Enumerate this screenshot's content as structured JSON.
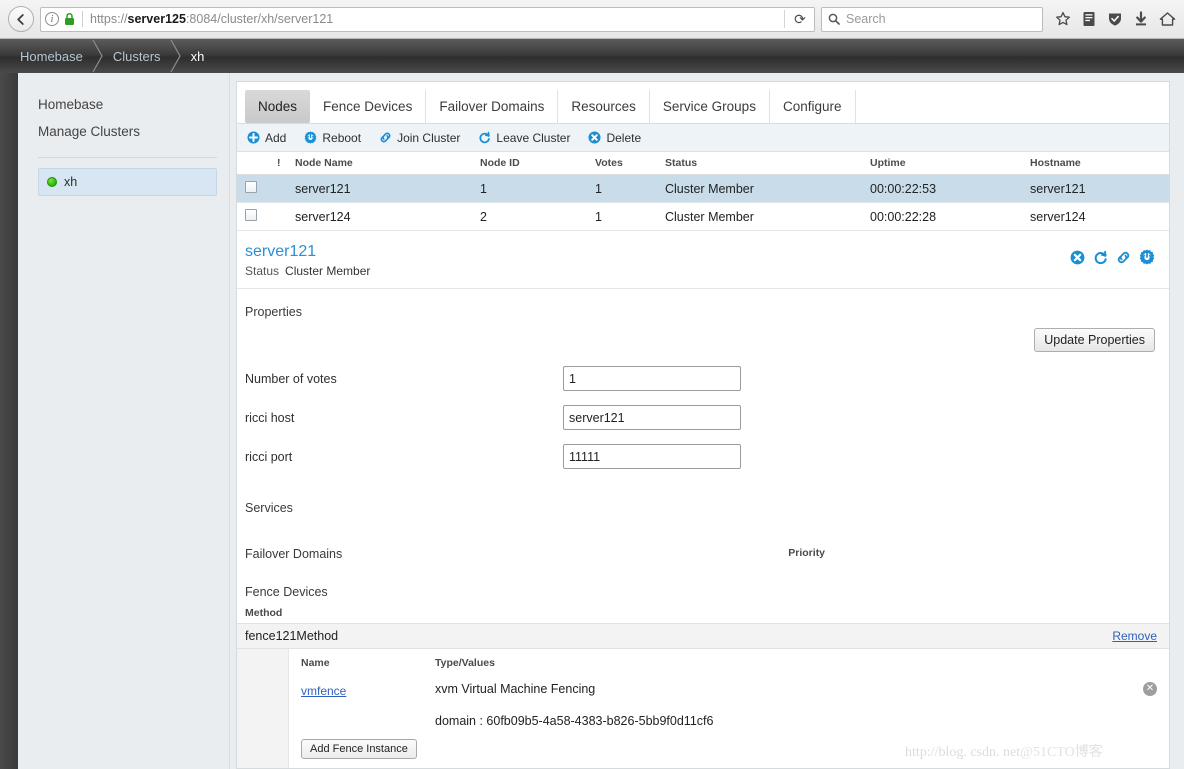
{
  "browser": {
    "back_icon": "back-arrow-icon",
    "info_icon": "info-icon",
    "lock_icon": "lock-icon",
    "url_prefix": "https://",
    "url_host": "server125",
    "url_rest": ":8084/cluster/xh/server121",
    "url_full": "https://server125:8084/cluster/xh/server121",
    "reload_icon": "reload-icon",
    "search_placeholder": "Search",
    "search_value": "",
    "icons": [
      "bookmark-star-icon",
      "library-icon",
      "shield-icon",
      "downloads-icon",
      "home-icon"
    ]
  },
  "breadcrumb": {
    "items": [
      {
        "label": "Homebase"
      },
      {
        "label": "Clusters"
      },
      {
        "label": "xh"
      }
    ]
  },
  "sidebar": {
    "links": [
      {
        "label": "Homebase"
      },
      {
        "label": "Manage Clusters"
      }
    ],
    "clusters": [
      {
        "label": "xh",
        "status_color": "#2db40b"
      }
    ]
  },
  "tabs": [
    {
      "label": "Nodes",
      "active": true
    },
    {
      "label": "Fence Devices",
      "active": false
    },
    {
      "label": "Failover Domains",
      "active": false
    },
    {
      "label": "Resources",
      "active": false
    },
    {
      "label": "Service Groups",
      "active": false
    },
    {
      "label": "Configure",
      "active": false
    }
  ],
  "toolbar": {
    "buttons": [
      {
        "label": "Add",
        "icon": "plus-circle-icon"
      },
      {
        "label": "Reboot",
        "icon": "power-gear-icon"
      },
      {
        "label": "Join Cluster",
        "icon": "link-icon"
      },
      {
        "label": "Leave Cluster",
        "icon": "leave-cluster-icon"
      },
      {
        "label": "Delete",
        "icon": "x-circle-icon"
      }
    ]
  },
  "nodes_table": {
    "headers": {
      "bang": "!",
      "node_name": "Node Name",
      "node_id": "Node ID",
      "votes": "Votes",
      "status": "Status",
      "uptime": "Uptime",
      "hostname": "Hostname"
    },
    "rows": [
      {
        "selected": true,
        "node_name": "server121",
        "node_id": "1",
        "votes": "1",
        "status": "Cluster Member",
        "uptime": "00:00:22:53",
        "hostname": "server121"
      },
      {
        "selected": false,
        "node_name": "server124",
        "node_id": "2",
        "votes": "1",
        "status": "Cluster Member",
        "uptime": "00:00:22:28",
        "hostname": "server124"
      }
    ]
  },
  "detail": {
    "title": "server121",
    "status_label": "Status",
    "status_value": "Cluster Member",
    "icons": [
      "delete-icon",
      "leave-cluster-icon",
      "join-cluster-icon",
      "reboot-icon"
    ],
    "accent_color": "#2b8fd4"
  },
  "properties": {
    "section_label": "Properties",
    "update_button": "Update Properties",
    "fields": [
      {
        "label": "Number of votes",
        "value": "1"
      },
      {
        "label": "ricci host",
        "value": "server121"
      },
      {
        "label": "ricci port",
        "value": "11111"
      }
    ]
  },
  "services": {
    "section_label": "Services"
  },
  "failover_domains": {
    "section_label": "Failover Domains",
    "priority_header": "Priority"
  },
  "fence_devices": {
    "section_label": "Fence Devices",
    "method_header": "Method",
    "method_name": "fence121Method",
    "remove_link": "Remove",
    "instance_headers": {
      "name": "Name",
      "type_values": "Type/Values"
    },
    "instances": [
      {
        "name": "vmfence",
        "type": "xvm Virtual Machine Fencing",
        "detail": "domain : 60fb09b5-4a58-4383-b826-5bb9f0d11cf6",
        "delete_icon": "x-circle-icon"
      }
    ],
    "add_instance_button": "Add Fence Instance"
  },
  "watermark": {
    "text": "http://blog. csdn. net",
    "suffix": "@51CTO博客"
  }
}
